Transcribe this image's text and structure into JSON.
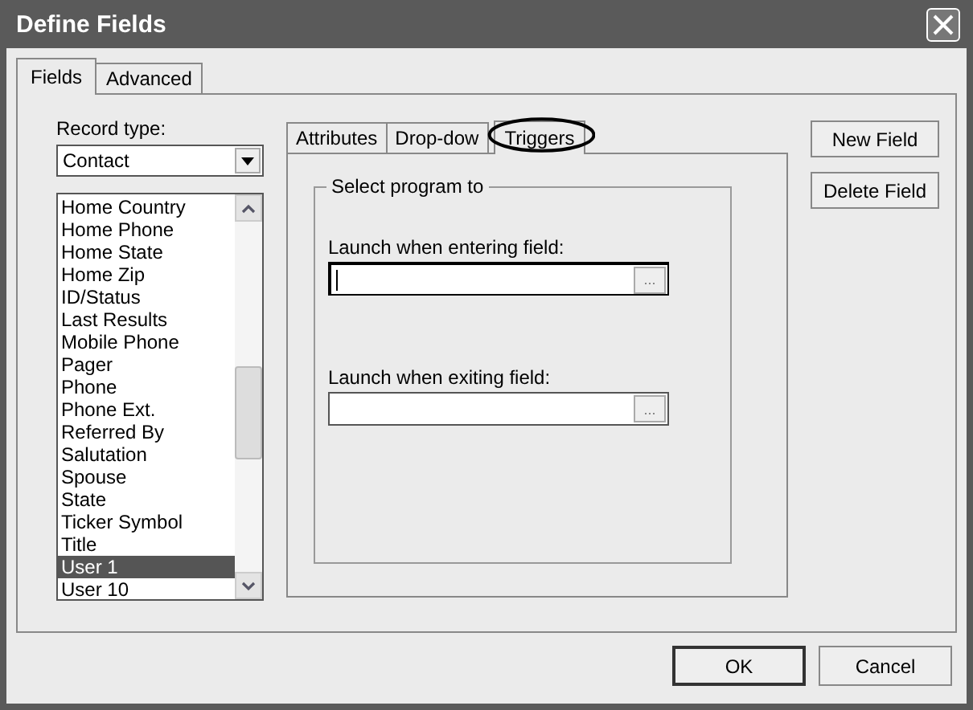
{
  "window": {
    "title": "Define Fields"
  },
  "tabs": [
    {
      "label": "Fields",
      "selected": true
    },
    {
      "label": "Advanced",
      "selected": false
    }
  ],
  "record_type": {
    "label": "Record type:",
    "value": "Contact"
  },
  "field_list": {
    "items": [
      {
        "label": "Home Country",
        "selected": false
      },
      {
        "label": "Home Phone",
        "selected": false
      },
      {
        "label": "Home State",
        "selected": false
      },
      {
        "label": "Home Zip",
        "selected": false
      },
      {
        "label": "ID/Status",
        "selected": false
      },
      {
        "label": "Last Results",
        "selected": false
      },
      {
        "label": "Mobile Phone",
        "selected": false
      },
      {
        "label": "Pager",
        "selected": false
      },
      {
        "label": "Phone",
        "selected": false
      },
      {
        "label": "Phone Ext.",
        "selected": false
      },
      {
        "label": "Referred By",
        "selected": false
      },
      {
        "label": "Salutation",
        "selected": false
      },
      {
        "label": "Spouse",
        "selected": false
      },
      {
        "label": "State",
        "selected": false
      },
      {
        "label": "Ticker Symbol",
        "selected": false
      },
      {
        "label": "Title",
        "selected": false
      },
      {
        "label": "User 1",
        "selected": true
      },
      {
        "label": "User 10",
        "selected": false
      }
    ]
  },
  "inner_tabs": [
    {
      "label": "Attributes",
      "selected": false
    },
    {
      "label": "Drop-dow",
      "selected": false
    },
    {
      "label": "Triggers",
      "selected": true,
      "circled": true
    }
  ],
  "group": {
    "title": "Select program to",
    "fields": [
      {
        "label": "Launch when entering field:",
        "focused": true,
        "browse": "..."
      },
      {
        "label": "Launch when exiting field:",
        "focused": false,
        "browse": "..."
      }
    ]
  },
  "side_buttons": [
    "New Field",
    "Delete Field"
  ],
  "buttons": [
    {
      "label": "OK",
      "default": true
    },
    {
      "label": "Cancel",
      "default": false
    }
  ]
}
